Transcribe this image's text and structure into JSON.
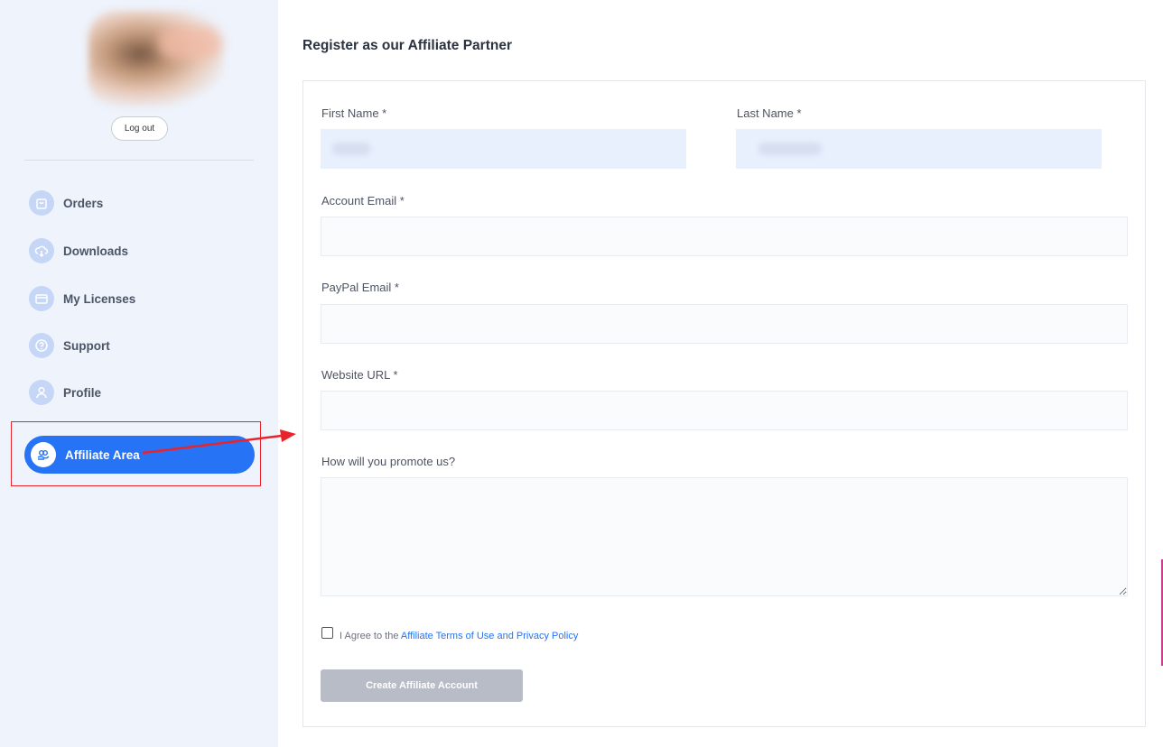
{
  "sidebar": {
    "logout_label": "Log out",
    "items": [
      {
        "label": "Orders",
        "icon": "shopping-bag-icon"
      },
      {
        "label": "Downloads",
        "icon": "cloud-download-icon"
      },
      {
        "label": "My Licenses",
        "icon": "credit-card-icon"
      },
      {
        "label": "Support",
        "icon": "question-circle-icon"
      },
      {
        "label": "Profile",
        "icon": "user-icon"
      },
      {
        "label": "Affiliate Area",
        "icon": "handshake-icon",
        "active": true
      }
    ]
  },
  "main": {
    "title": "Register as our Affiliate Partner",
    "form": {
      "first_name_label": "First Name *",
      "last_name_label": "Last Name *",
      "account_email_label": "Account Email *",
      "paypal_email_label": "PayPal Email *",
      "website_url_label": "Website URL *",
      "promote_label": "How will you promote us?",
      "agree_prefix": "I Agree to the ",
      "agree_link": "Affiliate Terms of Use and Privacy Policy",
      "submit_label": "Create Affiliate Account"
    }
  },
  "colors": {
    "accent": "#2673f5",
    "sidebar_bg": "#eef3fc",
    "annotation_red": "#e8232c",
    "button_disabled": "#b7bcc7"
  }
}
